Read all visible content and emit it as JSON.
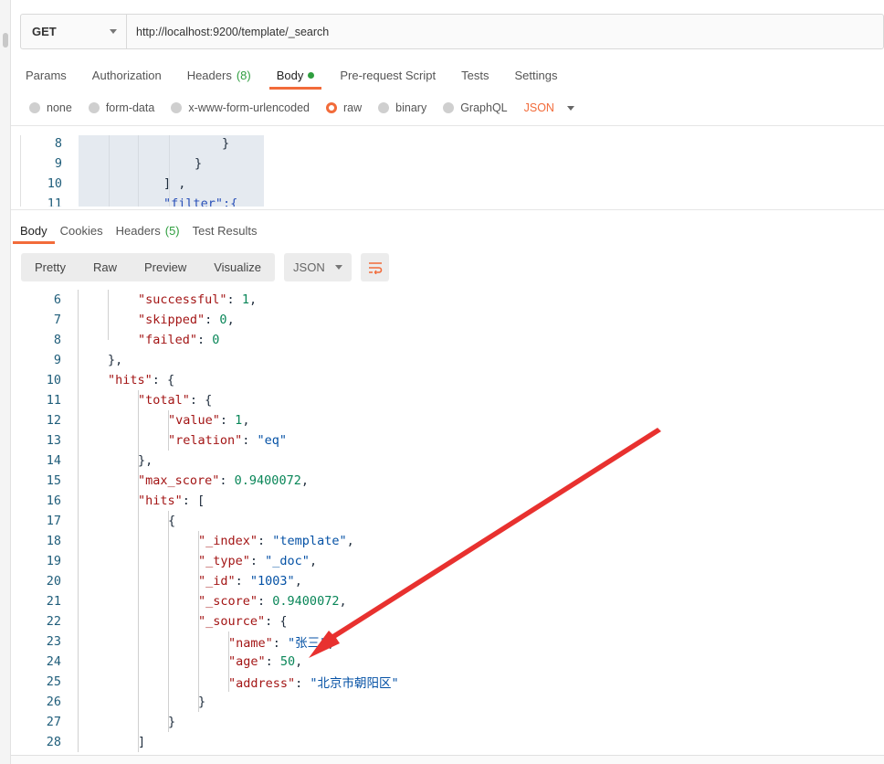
{
  "request": {
    "method": "GET",
    "url": "http://localhost:9200/template/_search"
  },
  "request_tabs": [
    {
      "label": "Params"
    },
    {
      "label": "Authorization"
    },
    {
      "label": "Headers",
      "count": "(8)"
    },
    {
      "label": "Body",
      "active": true
    },
    {
      "label": "Pre-request Script"
    },
    {
      "label": "Tests"
    },
    {
      "label": "Settings"
    }
  ],
  "body_types": [
    {
      "label": "none"
    },
    {
      "label": "form-data"
    },
    {
      "label": "x-www-form-urlencoded"
    },
    {
      "label": "raw",
      "selected": true
    },
    {
      "label": "binary"
    },
    {
      "label": "GraphQL"
    }
  ],
  "body_format": "JSON",
  "request_body_lines": [
    {
      "n": "8",
      "text": "}"
    },
    {
      "n": "9",
      "text": "}"
    },
    {
      "n": "10",
      "text": "] ,"
    },
    {
      "n": "11",
      "text": "\"filter\":{"
    }
  ],
  "response_tabs": [
    {
      "label": "Body",
      "active": true
    },
    {
      "label": "Cookies"
    },
    {
      "label": "Headers",
      "count": "(5)"
    },
    {
      "label": "Test Results"
    }
  ],
  "view_modes": [
    "Pretty",
    "Raw",
    "Preview",
    "Visualize"
  ],
  "response_format": "JSON",
  "response_lines": [
    {
      "n": "6",
      "tokens": [
        [
          "k",
          "\"successful\""
        ],
        [
          "p",
          ": "
        ],
        [
          "n",
          "1"
        ],
        [
          "p",
          ","
        ]
      ]
    },
    {
      "n": "7",
      "tokens": [
        [
          "k",
          "\"skipped\""
        ],
        [
          "p",
          ": "
        ],
        [
          "n",
          "0"
        ],
        [
          "p",
          ","
        ]
      ]
    },
    {
      "n": "8",
      "tokens": [
        [
          "k",
          "\"failed\""
        ],
        [
          "p",
          ": "
        ],
        [
          "n",
          "0"
        ]
      ]
    },
    {
      "n": "9",
      "tokens": [
        [
          "p",
          "},"
        ]
      ]
    },
    {
      "n": "10",
      "tokens": [
        [
          "k",
          "\"hits\""
        ],
        [
          "p",
          ": {"
        ]
      ]
    },
    {
      "n": "11",
      "tokens": [
        [
          "k",
          "\"total\""
        ],
        [
          "p",
          ": {"
        ]
      ]
    },
    {
      "n": "12",
      "tokens": [
        [
          "k",
          "\"value\""
        ],
        [
          "p",
          ": "
        ],
        [
          "n",
          "1"
        ],
        [
          "p",
          ","
        ]
      ]
    },
    {
      "n": "13",
      "tokens": [
        [
          "k",
          "\"relation\""
        ],
        [
          "p",
          ": "
        ],
        [
          "s",
          "\"eq\""
        ]
      ]
    },
    {
      "n": "14",
      "tokens": [
        [
          "p",
          "},"
        ]
      ]
    },
    {
      "n": "15",
      "tokens": [
        [
          "k",
          "\"max_score\""
        ],
        [
          "p",
          ": "
        ],
        [
          "n",
          "0.9400072"
        ],
        [
          "p",
          ","
        ]
      ]
    },
    {
      "n": "16",
      "tokens": [
        [
          "k",
          "\"hits\""
        ],
        [
          "p",
          ": ["
        ]
      ]
    },
    {
      "n": "17",
      "tokens": [
        [
          "p",
          "{"
        ]
      ]
    },
    {
      "n": "18",
      "tokens": [
        [
          "k",
          "\"_index\""
        ],
        [
          "p",
          ": "
        ],
        [
          "s",
          "\"template\""
        ],
        [
          "p",
          ","
        ]
      ]
    },
    {
      "n": "19",
      "tokens": [
        [
          "k",
          "\"_type\""
        ],
        [
          "p",
          ": "
        ],
        [
          "s",
          "\"_doc\""
        ],
        [
          "p",
          ","
        ]
      ]
    },
    {
      "n": "20",
      "tokens": [
        [
          "k",
          "\"_id\""
        ],
        [
          "p",
          ": "
        ],
        [
          "s",
          "\"1003\""
        ],
        [
          "p",
          ","
        ]
      ]
    },
    {
      "n": "21",
      "tokens": [
        [
          "k",
          "\"_score\""
        ],
        [
          "p",
          ": "
        ],
        [
          "n",
          "0.9400072"
        ],
        [
          "p",
          ","
        ]
      ]
    },
    {
      "n": "22",
      "tokens": [
        [
          "k",
          "\"_source\""
        ],
        [
          "p",
          ": {"
        ]
      ]
    },
    {
      "n": "23",
      "tokens": [
        [
          "k",
          "\"name\""
        ],
        [
          "p",
          ": "
        ],
        [
          "s",
          "\"张三\""
        ],
        [
          "p",
          ","
        ]
      ]
    },
    {
      "n": "24",
      "tokens": [
        [
          "k",
          "\"age\""
        ],
        [
          "p",
          ": "
        ],
        [
          "n",
          "50"
        ],
        [
          "p",
          ","
        ]
      ]
    },
    {
      "n": "25",
      "tokens": [
        [
          "k",
          "\"address\""
        ],
        [
          "p",
          ": "
        ],
        [
          "s",
          "\"北京市朝阳区\""
        ]
      ]
    },
    {
      "n": "26",
      "tokens": [
        [
          "p",
          "}"
        ]
      ]
    },
    {
      "n": "27",
      "tokens": [
        [
          "p",
          "}"
        ]
      ]
    },
    {
      "n": "28",
      "tokens": [
        [
          "p",
          "]"
        ]
      ]
    }
  ],
  "annotation": {
    "color": "#e8312f",
    "icon": "red-arrow-annotation"
  },
  "accent_color": "#f26b3a"
}
